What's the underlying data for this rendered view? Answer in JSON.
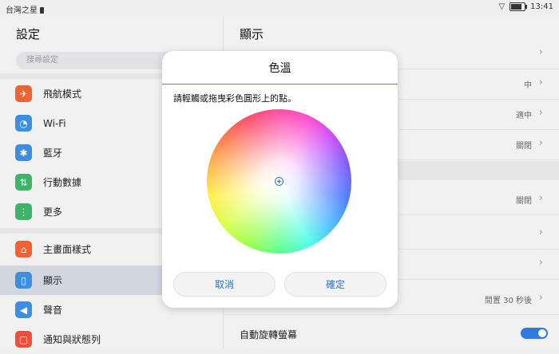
{
  "status_bar": {
    "carrier": "台灣之星",
    "time": "13:41",
    "battery_level": 0.8
  },
  "left_panel": {
    "title": "設定",
    "search_placeholder": "搜尋設定",
    "items": [
      {
        "label": "飛航模式",
        "icon": "airplane-icon",
        "color": "#f0622f"
      },
      {
        "label": "Wi-Fi",
        "icon": "wifi-icon",
        "color": "#3c8ee0"
      },
      {
        "label": "藍牙",
        "icon": "bluetooth-icon",
        "color": "#3c8ee0"
      },
      {
        "label": "行動數據",
        "icon": "mobile-data-icon",
        "color": "#3fb36a"
      },
      {
        "label": "更多",
        "icon": "more-icon",
        "color": "#3fb36a"
      },
      {
        "label": "主畫面樣式",
        "icon": "home-icon",
        "color": "#f0622f"
      },
      {
        "label": "顯示",
        "icon": "display-icon",
        "color": "#3c8ee0"
      },
      {
        "label": "聲音",
        "icon": "sound-icon",
        "color": "#3c8ee0"
      },
      {
        "label": "通知與狀態列",
        "icon": "notification-icon",
        "color": "#f04e3a"
      }
    ]
  },
  "right_panel": {
    "title": "顯示",
    "rows": [
      {
        "value": ""
      },
      {
        "value": "中"
      },
      {
        "value": "適中"
      },
      {
        "value": "關閉"
      },
      {
        "value": "關閉"
      },
      {
        "value": ""
      },
      {
        "value": ""
      },
      {
        "value": "閒置 30 秒後"
      }
    ],
    "auto_rotate_label": "自動旋轉螢幕"
  },
  "dialog": {
    "title": "色溫",
    "instruction": "請輕觸或拖曳彩色圓形上的點。",
    "cancel_label": "取消",
    "ok_label": "確定"
  }
}
